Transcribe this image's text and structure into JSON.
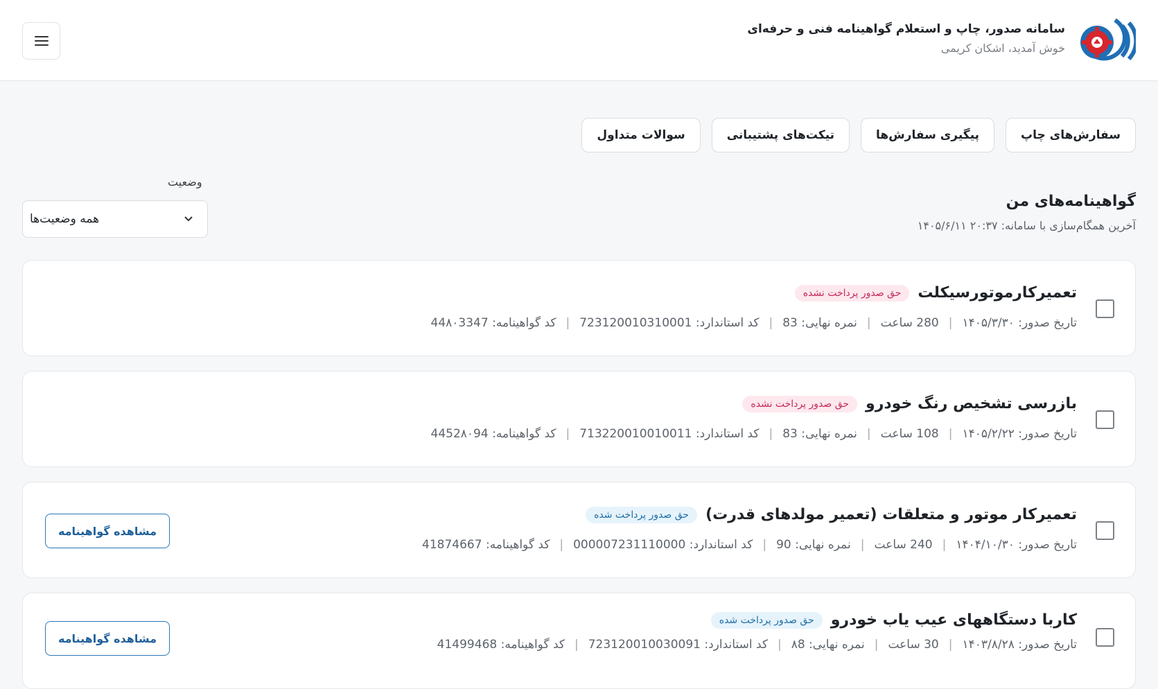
{
  "header": {
    "title": "سامانه صدور، چاپ و استعلام گواهینامه فنی و حرفه‌ای",
    "welcome": "خوش آمدید، اشکان کریمی"
  },
  "tabs": [
    {
      "label": "سفارش‌های چاپ"
    },
    {
      "label": "پیگیری سفارش‌ها"
    },
    {
      "label": "تیکت‌های پشتیبانی"
    },
    {
      "label": "سوالات متداول"
    }
  ],
  "filter": {
    "label": "وضعیت",
    "value": "همه وضعیت‌ها"
  },
  "section": {
    "title": "گواهینامه‌های من",
    "sync": "آخرین همگام‌سازی با سامانه: ۲۰:۳۷ ۱۴۰۵/۶/۱۱"
  },
  "labels": {
    "issue_date": "تاریخ صدور:",
    "hours_unit": "ساعت",
    "final_score": "نمره نهایی:",
    "standard_code": "کد استاندارد:",
    "cert_code": "کد گواهینامه:",
    "view_button": "مشاهده گواهینامه"
  },
  "certificates": [
    {
      "title": "تعمیرکارموتورسیکلت",
      "badge": "حق صدور پرداخت نشده",
      "issue_date": "۱۴۰۵/۳/۳۰",
      "hours": "280",
      "score": "83",
      "standard": "723120010310001",
      "code": "44۸۰3347",
      "has_view": false
    },
    {
      "title": "بازرسی تشخیص رنگ خودرو",
      "badge": "حق صدور پرداخت نشده",
      "issue_date": "۱۴۰۵/۲/۲۲",
      "hours": "108",
      "score": "83",
      "standard": "713220010010011",
      "code": "4452۸۰94",
      "has_view": false
    },
    {
      "title": "تعمیرکار موتور و متعلقات (تعمیر مولدهای قدرت)",
      "badge": "حق صدور پرداخت شده",
      "issue_date": "۱۴۰۴/۱۰/۳۰",
      "hours": "240",
      "score": "90",
      "standard": "000007231110000",
      "code": "41874667",
      "has_view": true
    },
    {
      "title": "کاربا دستگاههای عیب یاب خودرو",
      "badge": "حق صدور پرداخت شده",
      "issue_date": "۱۴۰۳/۸/۲۸",
      "hours": "30",
      "score": "۸8",
      "standard": "723120010030091",
      "code": "41499468",
      "has_view": true
    }
  ],
  "colors": {
    "brand_blue": "#1f6fb5",
    "brand_red": "#d7262e",
    "unpaid_badge_bg": "#fde8ee",
    "paid_badge_bg": "#e6f3fb"
  }
}
